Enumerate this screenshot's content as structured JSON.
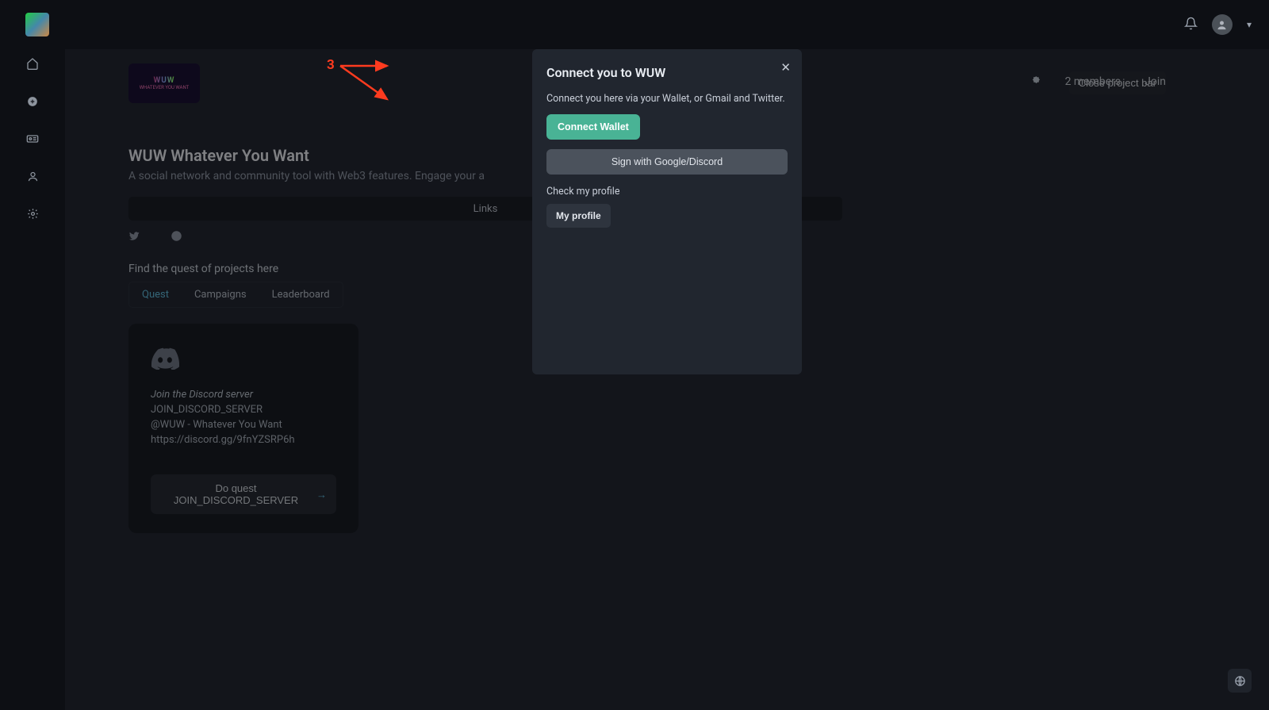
{
  "topbar": {
    "close_project_label": "Close project bar"
  },
  "sidebar": {},
  "project": {
    "logo_text": "WUW",
    "logo_sub": "WHATEVER YOU WANT",
    "title": "WUW Whatever You Want",
    "description": "A social network and community tool with Web3 features. Engage your a",
    "members": "2 members",
    "join_label": "Join",
    "links_bar": "Links",
    "find_quest_text": "Find the quest of projects here",
    "tabs": {
      "quest": "Quest",
      "campaigns": "Campaigns",
      "leaderboard": "Leaderboard"
    }
  },
  "quest_card": {
    "join_italic": "Join the Discord server",
    "line1": "JOIN_DISCORD_SERVER",
    "line2": "@WUW - Whatever You Want",
    "line3": "https://discord.gg/9fnYZSRP6h",
    "do_quest_label": "Do quest JOIN_DISCORD_SERVER"
  },
  "modal": {
    "title": "Connect you to WUW",
    "subtitle": "Connect you here via your Wallet, or Gmail and Twitter.",
    "connect_wallet": "Connect Wallet",
    "sign_google": "Sign with Google/Discord",
    "check_profile": "Check my profile",
    "my_profile": "My profile"
  },
  "annotation": {
    "number": "3"
  }
}
